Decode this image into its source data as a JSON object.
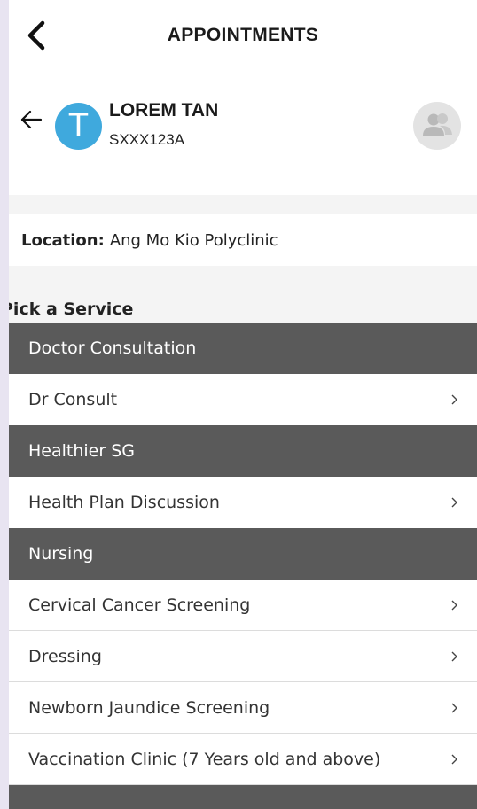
{
  "header": {
    "title": "APPOINTMENTS",
    "back_icon": "chevron-left-icon"
  },
  "profile": {
    "avatar_letter": "T",
    "name": "LOREM TAN",
    "id": "SXXX123A",
    "avatar_color": "#3fa9dd",
    "switch_icon": "users-icon"
  },
  "location": {
    "label": "Location:",
    "value": "Ang Mo Kio Polyclinic"
  },
  "section": {
    "title": "Pick a Service"
  },
  "groups": [
    {
      "header": "Doctor Consultation",
      "items": [
        "Dr Consult"
      ]
    },
    {
      "header": "Healthier SG",
      "items": [
        "Health Plan Discussion"
      ]
    },
    {
      "header": "Nursing",
      "items": [
        "Cervical Cancer Screening",
        "Dressing",
        "Newborn Jaundice Screening",
        "Vaccination Clinic (7 Years old and above)"
      ]
    }
  ],
  "colors": {
    "group_header_bg": "#5a5a5a",
    "background": "#f4f4f4",
    "outer_background": "#e8e4f1"
  }
}
